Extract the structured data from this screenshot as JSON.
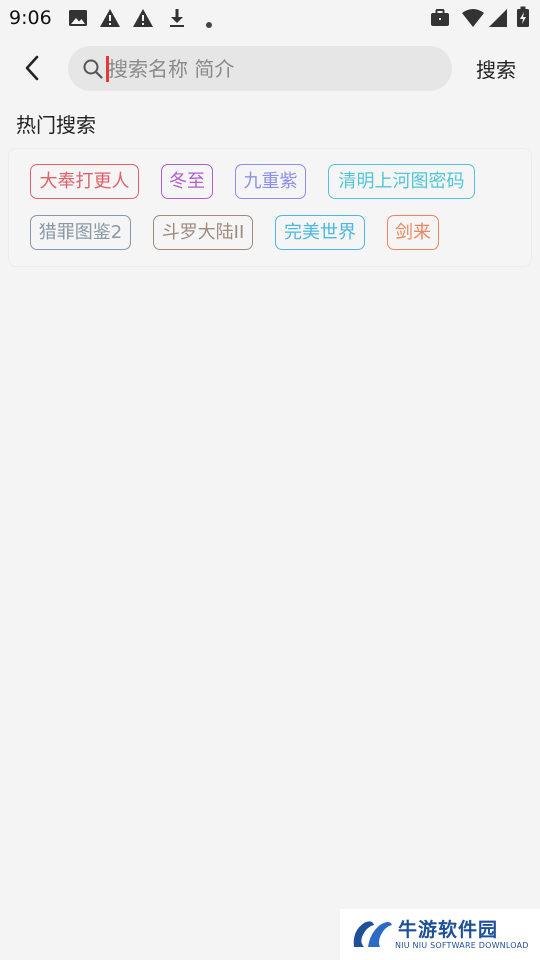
{
  "status_bar": {
    "time": "9:06",
    "left_icons": [
      "image-icon",
      "warning-icon",
      "warning-icon",
      "download-icon",
      "dot-icon"
    ],
    "right_icons": [
      "briefcase-icon",
      "wifi-icon",
      "signal-icon",
      "battery-icon"
    ]
  },
  "header": {
    "back_icon": "chevron-left-icon",
    "search_placeholder": "搜索名称 简介",
    "search_value": "",
    "search_button_label": "搜索"
  },
  "hot_search": {
    "title": "热门搜索",
    "tags": [
      {
        "label": "大奉打更人",
        "color": "#e2606a"
      },
      {
        "label": "冬至",
        "color": "#b05fc9"
      },
      {
        "label": "九重紫",
        "color": "#8e8ee8"
      },
      {
        "label": "清明上河图密码",
        "color": "#4fc6d6"
      },
      {
        "label": "猎罪图鉴2",
        "color": "#8898a8"
      },
      {
        "label": "斗罗大陆II",
        "color": "#a08a7e"
      },
      {
        "label": "完美世界",
        "color": "#4ab8e0"
      },
      {
        "label": "剑来",
        "color": "#ee8560"
      }
    ]
  },
  "watermark": {
    "title": "牛游软件园",
    "subtitle": "NIU NIU SOFTWARE DOWNLOAD"
  }
}
